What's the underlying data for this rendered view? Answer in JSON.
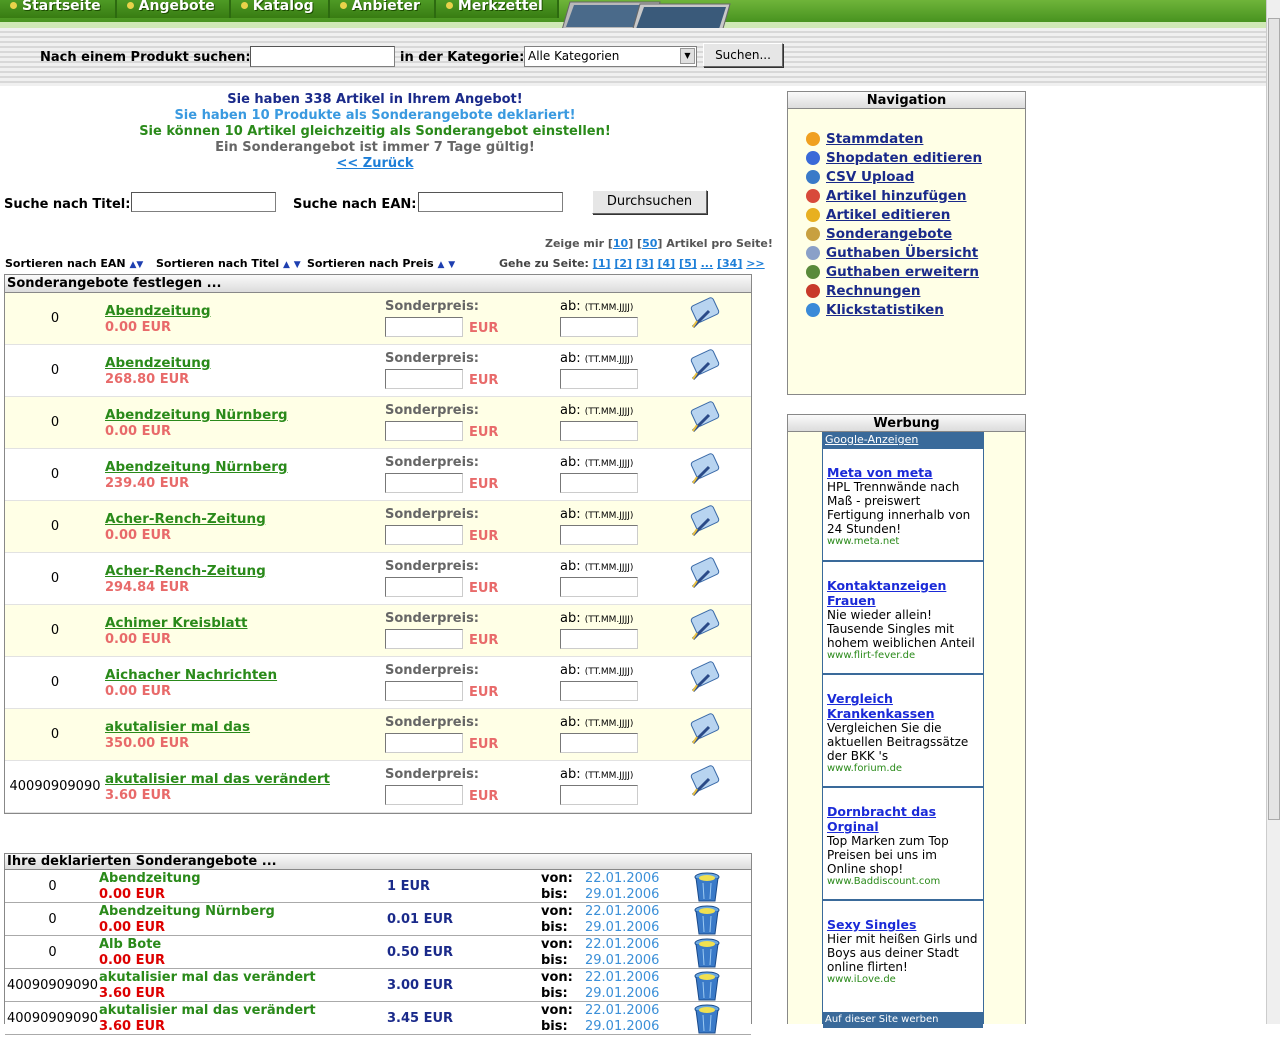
{
  "tabs": [
    "Startseite",
    "Angebote",
    "Katalog",
    "Anbieter",
    "Merkzettel"
  ],
  "search": {
    "label": "Nach einem Produkt suchen:",
    "category_label": "in der Kategorie:",
    "category_value": "Alle Kategorien",
    "button": "Suchen..."
  },
  "messages": {
    "m1": "Sie haben 338 Artikel in Ihrem Angebot!",
    "m2": "Sie haben 10 Produkte als Sonderangebote deklariert!",
    "m3": "Sie können 10 Artikel gleichzeitig als Sonderangebot einstellen!",
    "m4": "Ein Sonderangebot ist immer 7 Tage gültig!",
    "back": "<< Zurück"
  },
  "filter": {
    "title_label": "Suche nach Titel:",
    "ean_label": "Suche nach EAN:",
    "button": "Durchsuchen"
  },
  "perpage": {
    "prefix": "Zeige mir",
    "o1": "10",
    "o2": "50",
    "suffix": "Artikel pro Seite!"
  },
  "sort": {
    "ean": "Sortieren nach EAN",
    "title": "Sortieren nach Titel",
    "price": "Sortieren nach Preis"
  },
  "pager": {
    "label": "Gehe zu Seite:",
    "pages": [
      "[1]",
      "[2]",
      "[3]",
      "[4]",
      "[5]",
      "...",
      "[34]",
      ">>"
    ]
  },
  "offers": {
    "heading": "Sonderangebote festlegen ...",
    "sp_label": "Sonderpreis:",
    "eur": "EUR",
    "ab_label": "ab:",
    "date_hint": "(TT.MM.JJJJ)",
    "rows": [
      {
        "ean": "0",
        "title": "Abendzeitung",
        "price": "0.00 EUR"
      },
      {
        "ean": "0",
        "title": "Abendzeitung",
        "price": "268.80 EUR"
      },
      {
        "ean": "0",
        "title": "Abendzeitung Nürnberg",
        "price": "0.00 EUR"
      },
      {
        "ean": "0",
        "title": "Abendzeitung Nürnberg",
        "price": "239.40 EUR"
      },
      {
        "ean": "0",
        "title": "Acher-Rench-Zeitung",
        "price": "0.00 EUR"
      },
      {
        "ean": "0",
        "title": "Acher-Rench-Zeitung",
        "price": "294.84 EUR"
      },
      {
        "ean": "0",
        "title": "Achimer Kreisblatt",
        "price": "0.00 EUR"
      },
      {
        "ean": "0",
        "title": "Aichacher Nachrichten",
        "price": "0.00 EUR"
      },
      {
        "ean": "0",
        "title": "akutalisier mal das",
        "price": "350.00 EUR"
      },
      {
        "ean": "40090909090",
        "title": "akutalisier mal das verändert",
        "price": "3.60 EUR"
      }
    ]
  },
  "declared": {
    "heading": "Ihre deklarierten Sonderangebote ...",
    "von": "von:",
    "bis": "bis:",
    "rows": [
      {
        "ean": "0",
        "title": "Abendzeitung",
        "price": "0.00 EUR",
        "special": "1 EUR",
        "from": "22.01.2006",
        "to": "29.01.2006"
      },
      {
        "ean": "0",
        "title": "Abendzeitung Nürnberg",
        "price": "0.00 EUR",
        "special": "0.01 EUR",
        "from": "22.01.2006",
        "to": "29.01.2006"
      },
      {
        "ean": "0",
        "title": "Alb Bote",
        "price": "0.00 EUR",
        "special": "0.50 EUR",
        "from": "22.01.2006",
        "to": "29.01.2006"
      },
      {
        "ean": "40090909090",
        "title": "akutalisier mal das verändert",
        "price": "3.60 EUR",
        "special": "3.00 EUR",
        "from": "22.01.2006",
        "to": "29.01.2006"
      },
      {
        "ean": "40090909090",
        "title": "akutalisier mal das verändert",
        "price": "3.60 EUR",
        "special": "3.45 EUR",
        "from": "22.01.2006",
        "to": "29.01.2006"
      }
    ]
  },
  "navigation": {
    "heading": "Navigation",
    "items": [
      {
        "label": "Stammdaten",
        "icon": "home-icon",
        "color": "#f0a020"
      },
      {
        "label": "Shopdaten editieren",
        "icon": "shop-icon",
        "color": "#3a6ad8"
      },
      {
        "label": "CSV Upload",
        "icon": "monitor-icon",
        "color": "#3a7ac8"
      },
      {
        "label": "Artikel hinzufügen",
        "icon": "add-icon",
        "color": "#d84a3a"
      },
      {
        "label": "Artikel editieren",
        "icon": "edit-sign-icon",
        "color": "#e8b020"
      },
      {
        "label": "Sonderangebote",
        "icon": "tag-icon",
        "color": "#c8a040"
      },
      {
        "label": "Guthaben Übersicht",
        "icon": "document-icon",
        "color": "#8aa0c8"
      },
      {
        "label": "Guthaben erweitern",
        "icon": "user-icon",
        "color": "#5a8a3a"
      },
      {
        "label": "Rechnungen",
        "icon": "toolbox-icon",
        "color": "#c83a2a"
      },
      {
        "label": "Klickstatistiken",
        "icon": "help-icon",
        "color": "#3a8ad8"
      }
    ]
  },
  "werbung": {
    "heading": "Werbung",
    "google": "Google-Anzeigen",
    "ads": [
      {
        "title": "Meta von meta",
        "body": "HPL Trennwände nach Maß - preiswert Fertigung innerhalb von 24 Stunden!",
        "url": "www.meta.net"
      },
      {
        "title": "Kontaktanzeigen Frauen",
        "body": "Nie wieder allein! Tausende Singles mit hohem weiblichen Anteil",
        "url": "www.flirt-fever.de"
      },
      {
        "title": "Vergleich Krankenkassen",
        "body": "Vergleichen Sie die aktuellen Beitragssätze der BKK 's",
        "url": "www.forium.de"
      },
      {
        "title": "Dornbracht das Orginal",
        "body": "Top Marken zum Top Preisen bei uns im Online shop!",
        "url": "www.Baddiscount.com"
      },
      {
        "title": "Sexy Singles",
        "body": "Hier mit heißen Girls und Boys aus deiner Stadt online flirten!",
        "url": "www.iLove.de"
      }
    ],
    "footer": "Auf dieser Site werben"
  }
}
